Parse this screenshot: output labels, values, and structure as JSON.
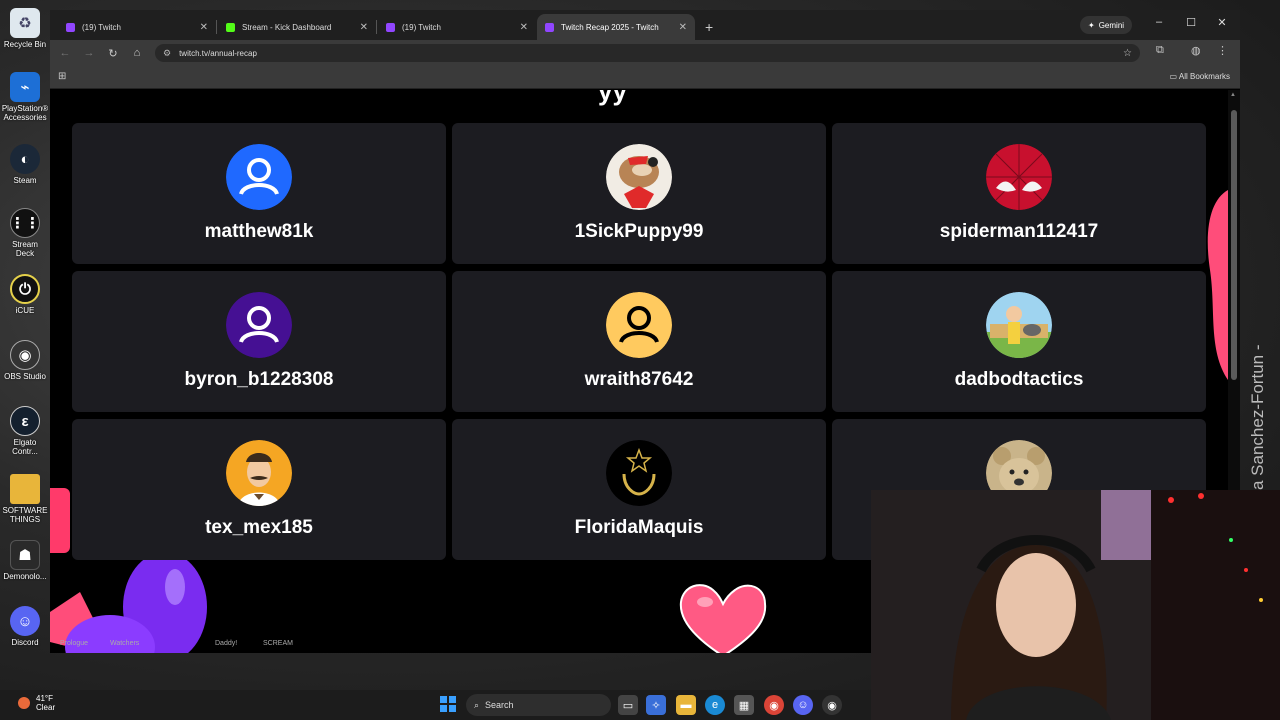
{
  "desktop": {
    "icons": [
      {
        "label": "Recycle Bin",
        "icon": "recycle-bin-icon"
      },
      {
        "label": "PlayStation®\nAccessories",
        "icon": "playstation-icon"
      },
      {
        "label": "Steam",
        "icon": "steam-icon"
      },
      {
        "label": "Stream Deck",
        "icon": "stream-deck-icon"
      },
      {
        "label": "iCUE",
        "icon": "icue-icon"
      },
      {
        "label": "OBS Studio",
        "icon": "obs-icon"
      },
      {
        "label": "Elgato\nContr...",
        "icon": "elgato-icon"
      },
      {
        "label": "SOFTWARE\nTHINGS",
        "icon": "folder-icon"
      },
      {
        "label": "Demonolo...",
        "icon": "demonologist-icon"
      },
      {
        "label": "Discord",
        "icon": "discord-icon"
      }
    ]
  },
  "browser": {
    "tabs": [
      {
        "title": "(19) Twitch",
        "color": "#9146ff",
        "active": false
      },
      {
        "title": "Stream - Kick Dashboard",
        "color": "#53fc18",
        "active": false
      },
      {
        "title": "(19) Twitch",
        "color": "#9146ff",
        "active": false
      },
      {
        "title": "Twitch Recap 2025 - Twitch",
        "color": "#9146ff",
        "active": true
      }
    ],
    "gemini_label": "Gemini",
    "url": "twitch.tv/annual-recap",
    "bookmarks_label": "All Bookmarks"
  },
  "page": {
    "top_fragment": "yy",
    "viewers": [
      {
        "name": "matthew81k",
        "avatar": "default-blue"
      },
      {
        "name": "1SickPuppy99",
        "avatar": "cartoon-dog"
      },
      {
        "name": "spiderman112417",
        "avatar": "spiderman"
      },
      {
        "name": "byron_b1228308",
        "avatar": "default-purple"
      },
      {
        "name": "wraith87642",
        "avatar": "default-yellow"
      },
      {
        "name": "dadbodtactics",
        "avatar": "cartoon-dad"
      },
      {
        "name": "tex_mex185",
        "avatar": "cartoon-mustache"
      },
      {
        "name": "FloridaMaquis",
        "avatar": "star-wreath"
      },
      {
        "name": "",
        "avatar": "teddy-bear"
      }
    ],
    "bottom_labels": [
      "Prologue",
      "Watchers",
      "Daddy!",
      "SCREAM"
    ]
  },
  "side_text": "a Sanchez-Fortun -",
  "taskbar": {
    "weather_temp": "41°F",
    "weather_desc": "Clear",
    "search_placeholder": "Search"
  }
}
